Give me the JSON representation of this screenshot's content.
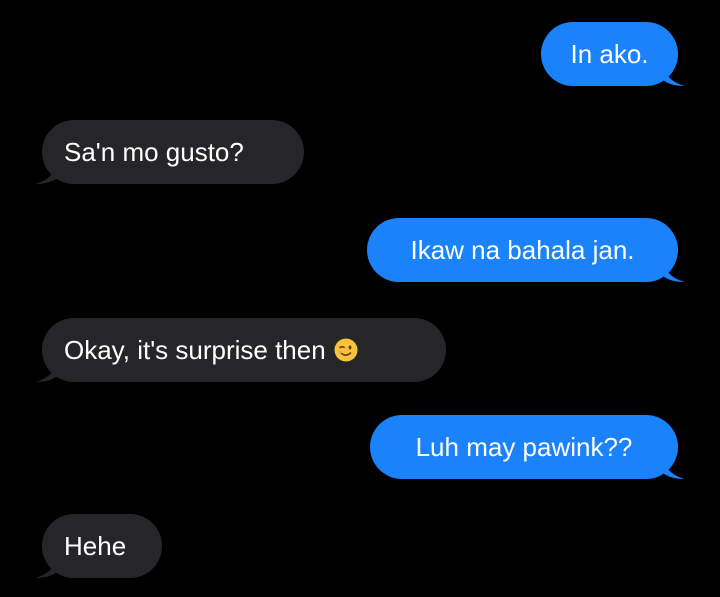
{
  "colors": {
    "background": "#000000",
    "sent_bubble": "#1a82fb",
    "received_bubble": "#262629",
    "text": "#ffffff"
  },
  "messages": [
    {
      "direction": "sent",
      "text": "In ako."
    },
    {
      "direction": "received",
      "text": "Sa'n mo gusto?"
    },
    {
      "direction": "sent",
      "text": "Ikaw na bahala jan."
    },
    {
      "direction": "received",
      "text": "Okay, it's surprise then",
      "emoji": "winking-face-emoji"
    },
    {
      "direction": "sent",
      "text": "Luh may pawink??"
    },
    {
      "direction": "received",
      "text": "Hehe"
    }
  ]
}
